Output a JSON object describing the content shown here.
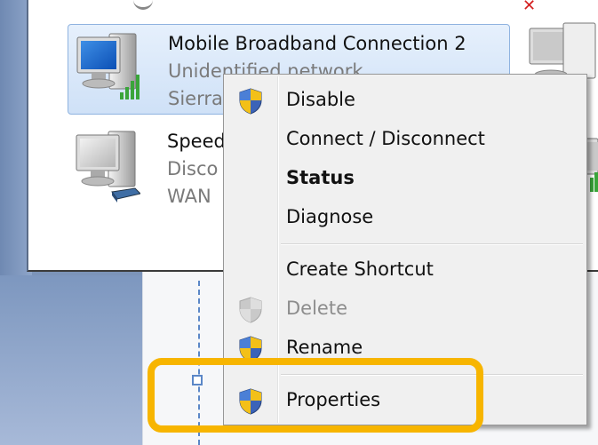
{
  "connections": [
    {
      "name": "Mobile Broadband Connection 2",
      "status": "Unidentified network",
      "device": "Sierra",
      "selected": true,
      "icon": "computer-signal-icon"
    },
    {
      "name": "Speed",
      "status": "Disco",
      "device": "WAN",
      "selected": false,
      "icon": "computer-modem-icon"
    }
  ],
  "context_menu": {
    "items": [
      {
        "label": "Disable",
        "icon": "uac-shield-icon",
        "style": "normal"
      },
      {
        "label": "Connect / Disconnect",
        "icon": "",
        "style": "normal"
      },
      {
        "label": "Status",
        "icon": "",
        "style": "bold"
      },
      {
        "label": "Diagnose",
        "icon": "",
        "style": "normal"
      },
      {
        "label": "Create Shortcut",
        "icon": "",
        "style": "normal"
      },
      {
        "label": "Delete",
        "icon": "uac-shield-icon",
        "style": "disabled"
      },
      {
        "label": "Rename",
        "icon": "uac-shield-icon",
        "style": "normal"
      },
      {
        "label": "Properties",
        "icon": "uac-shield-icon",
        "style": "normal"
      }
    ]
  },
  "colors": {
    "highlight": "#f7b500",
    "selection": "#cfe1f7",
    "signal": "#3aa53a"
  }
}
